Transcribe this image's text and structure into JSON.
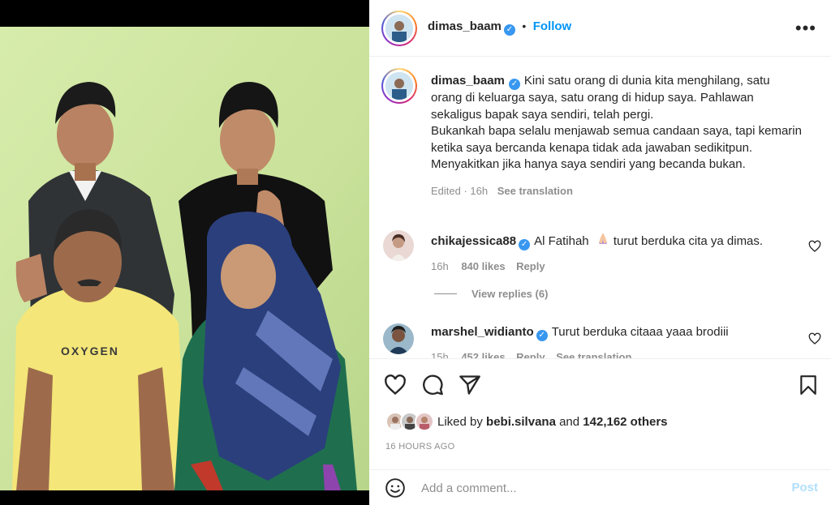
{
  "post": {
    "author": "dimas_baam",
    "follow_label": "Follow",
    "separator": "•",
    "more_label": "•••"
  },
  "caption": {
    "username": "dimas_baam",
    "text_1": "Kini satu orang di dunia kita menghilang, satu orang di keluarga saya, satu orang di hidup saya. Pahlawan sekaligus bapak saya sendiri, telah pergi.",
    "text_2": "Bukankah bapa selalu menjawab semua candaan saya, tapi kemarin ketika saya bercanda kenapa tidak ada jawaban sedikitpun. Menyakitkan jika hanya saya sendiri yang becanda bukan.",
    "edited": "Edited · 16h",
    "see_translation": "See translation"
  },
  "comments": [
    {
      "username": "chikajessica88",
      "text_a": "Al Fatihah",
      "text_b": "turut berduka cita ya dimas.",
      "time": "16h",
      "likes": "840 likes",
      "reply": "Reply",
      "view_replies": "View replies (6)"
    },
    {
      "username": "marshel_widianto",
      "text": "Turut berduka citaaa yaaa brodiii",
      "time": "15h",
      "likes": "452 likes",
      "reply": "Reply",
      "see_translation": "See translation"
    }
  ],
  "liked_by": {
    "prefix": "Liked by",
    "user": "bebi.silvana",
    "and": "and",
    "others": "142,162 others"
  },
  "timestamp": "16 HOURS AGO",
  "comment_box": {
    "placeholder": "Add a comment...",
    "post_label": "Post"
  },
  "icons": [
    "like-heart-icon",
    "comment-icon",
    "share-icon",
    "bookmark-icon",
    "emoji-icon",
    "more-options-icon",
    "verified-badge-icon"
  ],
  "colors": {
    "follow_blue": "#0095f6",
    "post_disabled": "#b2dffc",
    "verified": "#3897f0",
    "wall_green": "#cfe6a0"
  }
}
